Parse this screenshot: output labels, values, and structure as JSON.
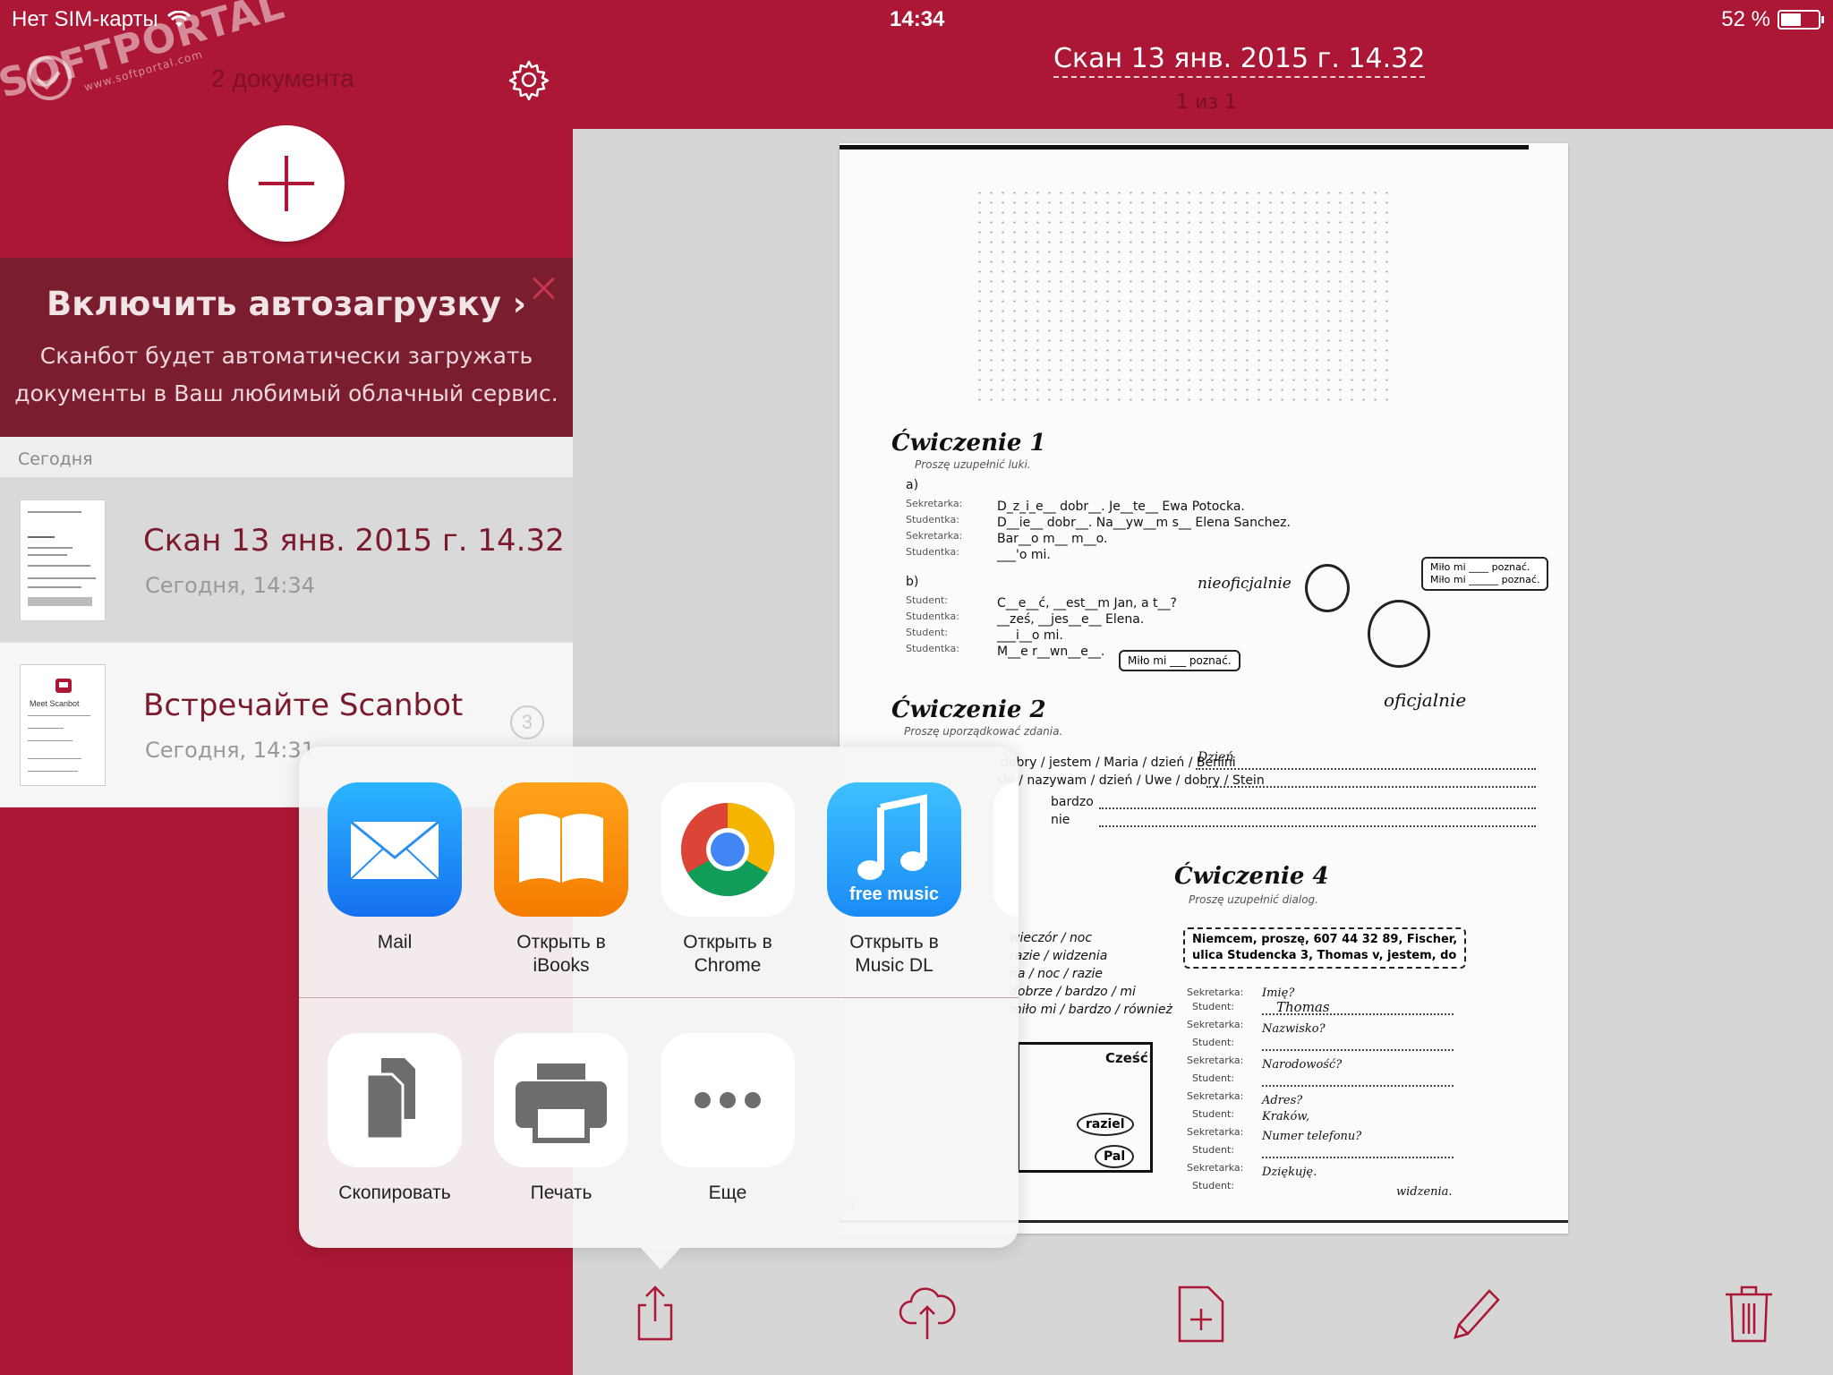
{
  "status_bar": {
    "carrier": "Нет SIM-карты",
    "time": "14:34",
    "battery": "52 %"
  },
  "watermark": {
    "text": "SOFTPORTAL",
    "url": "www.softportal.com",
    "tm": "TM"
  },
  "sidebar": {
    "doc_count": "2 документа",
    "banner": {
      "title": "Включить автозагрузку ›",
      "text_line1": "Сканбот будет автоматически загружать",
      "text_line2": "документы в Ваш любимый облачный сервис."
    },
    "section": "Сегодня",
    "documents": [
      {
        "title": "Скан 13 янв. 2015 г. 14.32",
        "date": "Сегодня, 14:34",
        "selected": true
      },
      {
        "title": "Встречайте Scanbot",
        "date": "Сегодня, 14:31",
        "badge": "3",
        "selected": false
      }
    ],
    "thumb_meet": "Meet Scanbot"
  },
  "header": {
    "title": "Скан 13 янв. 2015 г. 14.32",
    "page": "1 из 1"
  },
  "paper": {
    "ex1": "Ćwiczenie 1",
    "ex1_sub": "Proszę uzupełnić luki.",
    "ex1_a": "a)",
    "ex1_lines_a": [
      {
        "role": "Sekretarka:",
        "text": "D_z_i_e__ dobr__. Je__te__ Ewa Potocka."
      },
      {
        "role": "Studentka:",
        "text": "D__ie__ dobr__. Na__yw__m s__ Elena Sanchez."
      },
      {
        "role": "Sekretarka:",
        "text": "Bar__o m__ m__o."
      },
      {
        "role": "Studentka:",
        "text": "___'o mi."
      }
    ],
    "ex1_b": "b)",
    "ex1_lines_b": [
      {
        "role": "Student:",
        "text": "C__e__ć, __est__m Jan, a t__?"
      },
      {
        "role": "Studentka:",
        "text": "__ześ, __jes__e__ Elena."
      },
      {
        "role": "Student:",
        "text": "___i__o mi."
      },
      {
        "role": "Studentka:",
        "text": "M__e r__wn__e__."
      }
    ],
    "nieoficjalnie": "nieoficjalnie",
    "oficjalnie": "oficjalnie",
    "bubble1_l1": "Miło mi ____ poznać.",
    "bubble1_l2": "Miło mi ______ poznać.",
    "bubble2": "Miło mi ___ poznać.",
    "ex2": "Ćwiczenie 2",
    "ex2_sub": "Proszę uporządkować zdania.",
    "ex2_lines": [
      "dobry / jestem / Maria / dzień / Benini",
      "się / nazywam / dzień / Uwe / dobry / Stein",
      "bardzo",
      "nie"
    ],
    "ex2_answer": "Dzień",
    "ex4": "Ćwiczenie 4",
    "ex4_sub": "Proszę uzupełnić dialog.",
    "ex4_box_l1": "Niemcem, proszę, 607 44 32 89, Fischer,",
    "ex4_box_l2": "ulica Studencka 3, Thomas v, jestem, do",
    "ex4_roles": [
      "Sekretarka:",
      "Student:",
      "Sekretarka:",
      "Student:",
      "Sekretarka:",
      "Student:",
      "Sekretarka:",
      "Student:",
      "Sekretarka:",
      "Student:",
      "Sekretarka:",
      "Student:"
    ],
    "ex4_answers": [
      "Imię?",
      "Thomas",
      "Nazwisko?",
      "",
      "Narodowość?",
      "",
      "Adres?",
      "Kraków,",
      "Numer telefonu?",
      "",
      "Dziękuję.",
      "widzenia."
    ],
    "ex3_lines": [
      "wieczór / noc",
      "razie / widzenia",
      "na / noc / razie",
      "dobrze / bardzo / mi",
      "miło mi / bardzo / również"
    ],
    "cartoon_1": "Cześć!",
    "cartoon_2": "raziel",
    "cartoon_3": "Pal",
    "page_num": "4"
  },
  "share_sheet": {
    "apps": [
      {
        "label": "Mail",
        "icon": "mail-icon"
      },
      {
        "label": "Открыть в iBooks",
        "icon": "ibooks-icon"
      },
      {
        "label": "Открыть в Chrome",
        "icon": "chrome-icon"
      },
      {
        "label": "Открыть в Music DL",
        "icon": "music-dl-icon",
        "badge": "free music"
      }
    ],
    "actions": [
      {
        "label": "Скопировать",
        "icon": "copy-icon"
      },
      {
        "label": "Печать",
        "icon": "print-icon"
      },
      {
        "label": "Еще",
        "icon": "more-icon"
      }
    ]
  },
  "toolbar": {
    "icons": [
      "share-icon",
      "cloud-upload-icon",
      "add-page-icon",
      "edit-icon",
      "trash-icon"
    ]
  },
  "colors": {
    "brand": "#ab1734",
    "banner": "#7a1d2e"
  }
}
